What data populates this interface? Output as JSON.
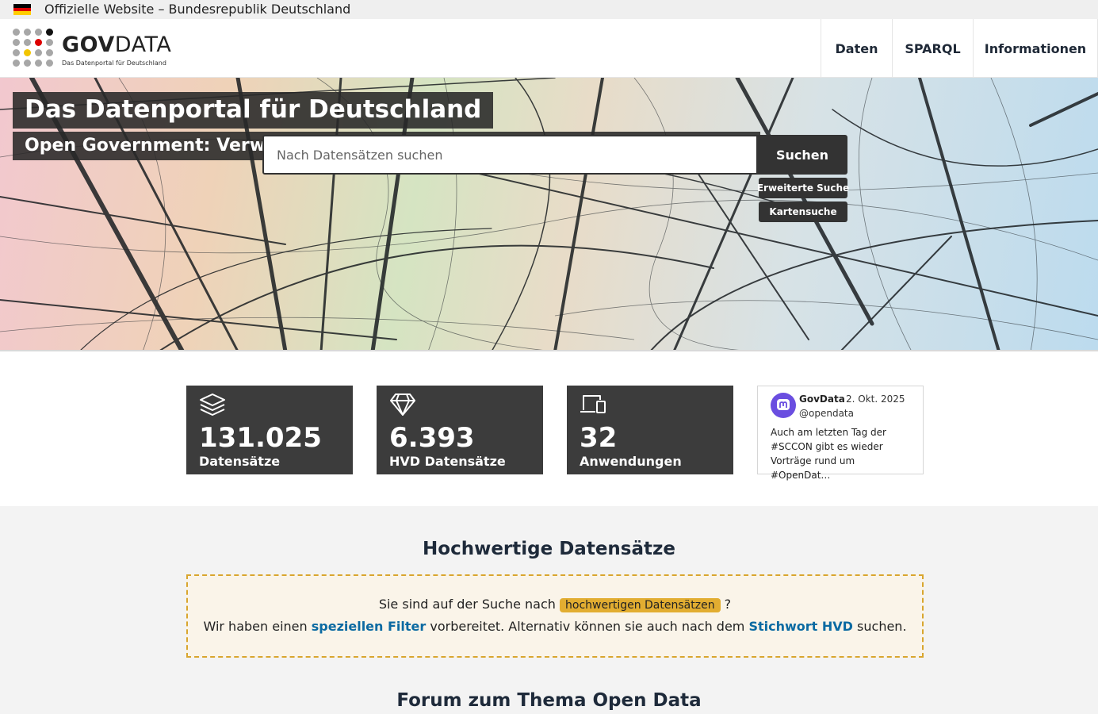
{
  "official_bar": {
    "text": "Offizielle Website – Bundesrepublik Deutschland"
  },
  "logo": {
    "name_bold": "GOV",
    "name_thin": "DATA",
    "subtitle": "Das Datenportal für Deutschland"
  },
  "nav": {
    "items": [
      {
        "label": "Daten"
      },
      {
        "label": "SPARQL"
      },
      {
        "label": "Informationen"
      }
    ]
  },
  "hero": {
    "title": "Das Datenportal für Deutschland",
    "subtitle": "Open Government: Verwaltungsdaten transparent, offen und frei nutzbar",
    "search_placeholder": "Nach Datensätzen suchen",
    "search_button": "Suchen",
    "advanced_search": "Erweiterte Suche",
    "map_search": "Kartensuche"
  },
  "stats": [
    {
      "value": "131.025",
      "label": "Datensätze",
      "icon": "layers-icon"
    },
    {
      "value": "6.393",
      "label": "HVD Datensätze",
      "icon": "diamond-icon"
    },
    {
      "value": "32",
      "label": "Anwendungen",
      "icon": "devices-icon"
    }
  ],
  "mastodon": {
    "name": "GovData",
    "date": "2. Okt. 2025",
    "handle": "@opendata",
    "text": "Auch am letzten Tag der #SCCON gibt es wieder Vorträge rund um #OpenDat…"
  },
  "hvd": {
    "title": "Hochwertige Datensätze",
    "line1_pre": "Sie sind auf der Suche nach",
    "line1_highlight": "hochwertigen Datensätzen",
    "line1_post": "?",
    "line2_pre": "Wir haben einen",
    "line2_link1": "speziellen Filter",
    "line2_mid": "vorbereitet. Alternativ können sie auch nach dem",
    "line2_link2": "Stichwort HVD",
    "line2_post": "suchen."
  },
  "forum": {
    "title": "Forum zum Thema Open Data"
  },
  "colors": {
    "flag_black": "#000000",
    "flag_red": "#dd0000",
    "flag_gold": "#ffce00",
    "dark_tile": "#3c3c3c",
    "hvd_border": "#d9a62e",
    "link": "#0b6aa2"
  }
}
